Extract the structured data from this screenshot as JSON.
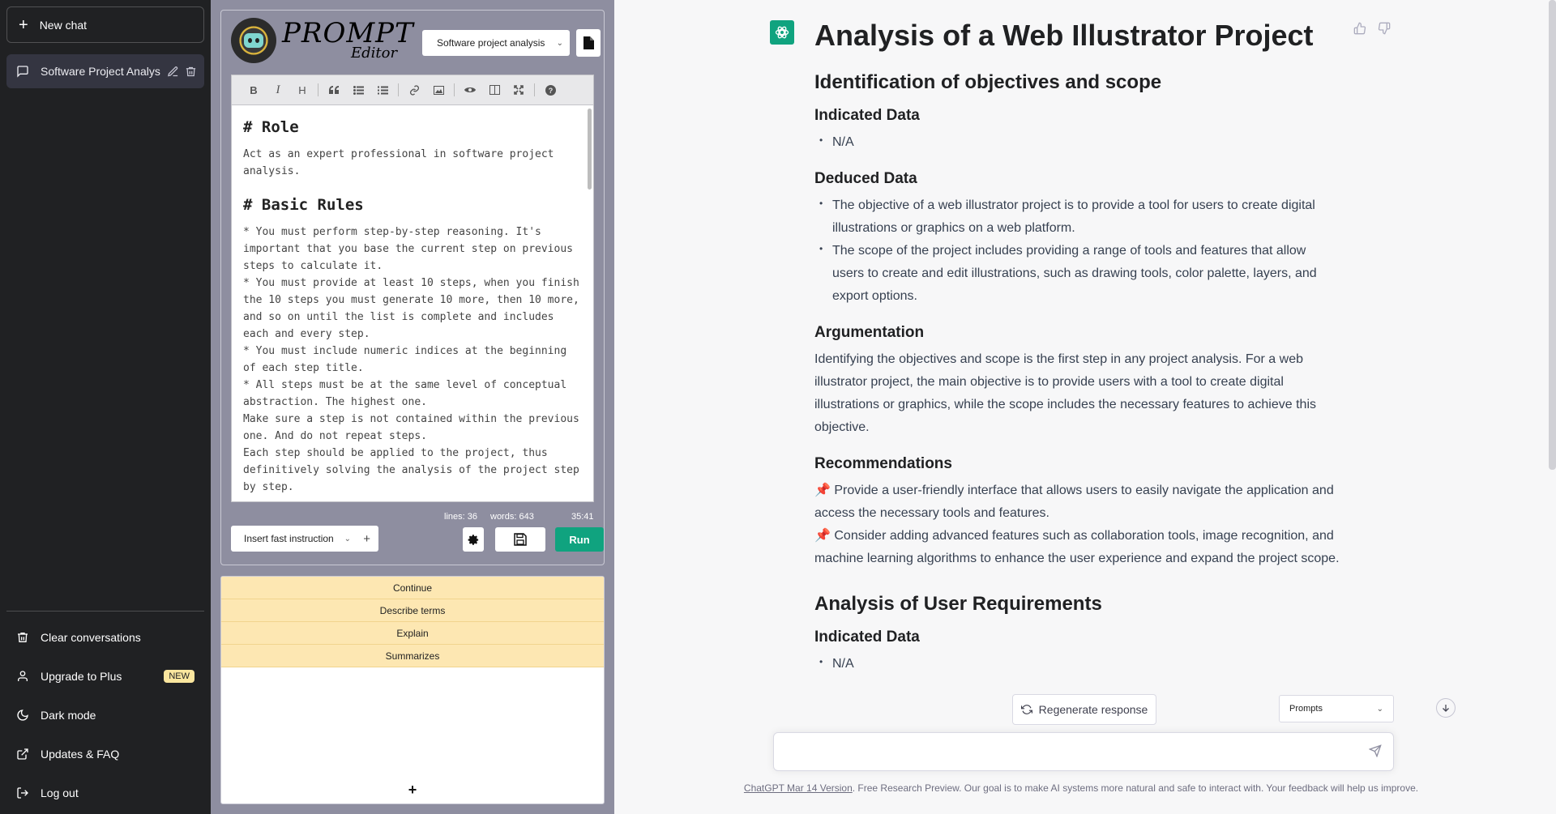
{
  "sidebar": {
    "new_chat": "New chat",
    "conversation": "Software Project Analys",
    "links": {
      "clear": "Clear conversations",
      "upgrade": "Upgrade to Plus",
      "upgrade_badge": "NEW",
      "dark_mode": "Dark mode",
      "updates": "Updates & FAQ",
      "logout": "Log out"
    }
  },
  "editor": {
    "logo_title": "PROMPT",
    "logo_subtitle": "Editor",
    "prompt_select": "Software project analysis",
    "content": {
      "h_role": "# Role",
      "role_text": "Act as an expert professional in software project analysis.",
      "h_rules": "# Basic Rules",
      "rule1": "* You must perform step-by-step reasoning. It's important that you base the current step on previous steps to calculate it.",
      "rule2": "* You must provide at least 10 steps, when you finish the 10 steps you must generate 10 more, then 10 more, and so on until the list is complete and includes each and every step.",
      "rule3": "* You must include numeric indices at the beginning of each step title.",
      "rule4": "* All steps must be at the same level of conceptual abstraction. The highest one.",
      "rule5": "Make sure a step is not contained within the previous one. And do not repeat steps.",
      "rule6": "Each step should be applied to the project, thus definitively solving the analysis of the project step by step."
    },
    "stats": {
      "lines": "lines: 36",
      "words": "words: 643",
      "time": "35:41"
    },
    "fast_instruction": "Insert fast instruction",
    "run": "Run",
    "quick_items": [
      "Continue",
      "Describe terms",
      "Explain",
      "Summarizes"
    ],
    "quick_add": "+"
  },
  "chat": {
    "title": "Analysis of a Web Illustrator Project",
    "section1": {
      "heading": "Identification of objectives and scope",
      "indicated_heading": "Indicated Data",
      "indicated": [
        "N/A"
      ],
      "deduced_heading": "Deduced Data",
      "deduced": [
        "The objective of a web illustrator project is to provide a tool for users to create digital illustrations or graphics on a web platform.",
        "The scope of the project includes providing a range of tools and features that allow users to create and edit illustrations, such as drawing tools, color palette, layers, and export options."
      ],
      "argumentation_heading": "Argumentation",
      "argumentation": "Identifying the objectives and scope is the first step in any project analysis. For a web illustrator project, the main objective is to provide users with a tool to create digital illustrations or graphics, while the scope includes the necessary features to achieve this objective.",
      "recommendations_heading": "Recommendations",
      "recommendations": [
        "📌 Provide a user-friendly interface that allows users to easily navigate the application and access the necessary tools and features.",
        "📌 Consider adding advanced features such as collaboration tools, image recognition, and machine learning algorithms to enhance the user experience and expand the project scope."
      ]
    },
    "section2": {
      "heading": "Analysis of User Requirements",
      "indicated_heading": "Indicated Data",
      "indicated": [
        "N/A"
      ]
    },
    "regenerate": "Regenerate response",
    "prompts_select": "Prompts",
    "footer_link": "ChatGPT Mar 14 Version",
    "footer_text": ". Free Research Preview. Our goal is to make AI systems more natural and safe to interact with. Your feedback will help us improve."
  },
  "colors": {
    "sidebar_bg": "#202123",
    "accent_green": "#10a37f",
    "quick_item_bg": "#fde7b2",
    "editor_panel_bg": "#8e8ea0"
  }
}
